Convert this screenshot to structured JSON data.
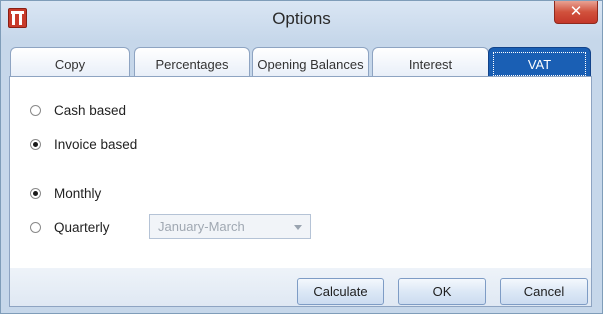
{
  "window": {
    "title": "Options"
  },
  "tabs": [
    {
      "label": "Copy"
    },
    {
      "label": "Percentages"
    },
    {
      "label": "Opening Balances"
    },
    {
      "label": "Interest"
    },
    {
      "label": "VAT",
      "selected": true
    }
  ],
  "vat": {
    "basis": [
      {
        "label": "Cash based",
        "checked": false
      },
      {
        "label": "Invoice based",
        "checked": true
      }
    ],
    "period": [
      {
        "label": "Monthly",
        "checked": true
      },
      {
        "label": "Quarterly",
        "checked": false
      }
    ],
    "quarter_select": {
      "value": "January-March",
      "enabled": false
    }
  },
  "buttons": {
    "calculate": "Calculate",
    "ok": "OK",
    "cancel": "Cancel"
  },
  "icons": {
    "app": "app-icon",
    "close": "close-icon",
    "dropdown": "chevron-down-icon"
  },
  "colors": {
    "accent": "#1a5fb4",
    "close": "#c4372a",
    "window_bg": "#c6d7ea"
  }
}
